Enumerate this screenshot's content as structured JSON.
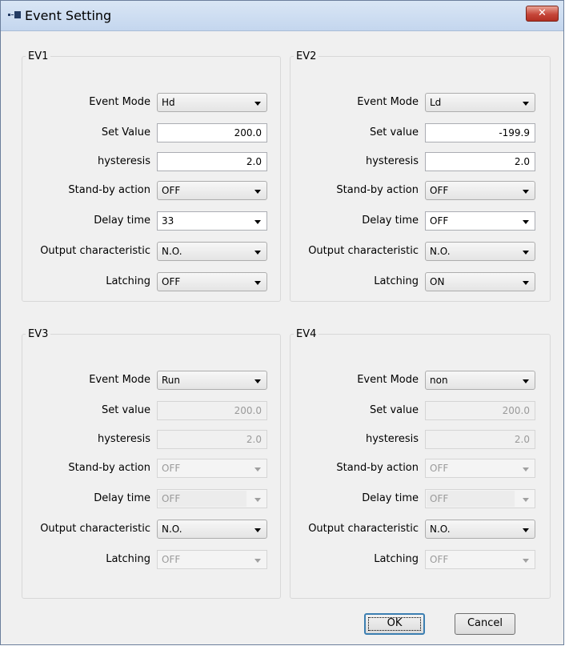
{
  "window": {
    "title": "Event Setting",
    "close_glyph": "✕"
  },
  "groups": [
    {
      "title": "EV1",
      "rows": [
        {
          "label": "Event Mode",
          "value": "Hd",
          "kind": "combo"
        },
        {
          "label": "Set Value",
          "value": "200.0",
          "kind": "edit"
        },
        {
          "label": "hysteresis",
          "value": "2.0",
          "kind": "edit"
        },
        {
          "label": "Stand-by action",
          "value": "OFF",
          "kind": "combo"
        },
        {
          "label": "Delay time",
          "value": "33",
          "kind": "combo-white"
        },
        {
          "label": "Output characteristic",
          "value": "N.O.",
          "kind": "combo"
        },
        {
          "label": "Latching",
          "value": "OFF",
          "kind": "combo"
        }
      ]
    },
    {
      "title": "EV2",
      "rows": [
        {
          "label": "Event Mode",
          "value": "Ld",
          "kind": "combo"
        },
        {
          "label": "Set value",
          "value": "-199.9",
          "kind": "edit"
        },
        {
          "label": "hysteresis",
          "value": "2.0",
          "kind": "edit"
        },
        {
          "label": "Stand-by action",
          "value": "OFF",
          "kind": "combo"
        },
        {
          "label": "Delay time",
          "value": "OFF",
          "kind": "combo-white"
        },
        {
          "label": "Output characteristic",
          "value": "N.O.",
          "kind": "combo"
        },
        {
          "label": "Latching",
          "value": "ON",
          "kind": "combo"
        }
      ]
    },
    {
      "title": "EV3",
      "rows": [
        {
          "label": "Event Mode",
          "value": "Run",
          "kind": "combo"
        },
        {
          "label": "Set value",
          "value": "200.0",
          "kind": "edit-disabled"
        },
        {
          "label": "hysteresis",
          "value": "2.0",
          "kind": "edit-disabled"
        },
        {
          "label": "Stand-by action",
          "value": "OFF",
          "kind": "combo-disabled"
        },
        {
          "label": "Delay time",
          "value": "OFF",
          "kind": "combo-disabled-edit"
        },
        {
          "label": "Output characteristic",
          "value": "N.O.",
          "kind": "combo"
        },
        {
          "label": "Latching",
          "value": "OFF",
          "kind": "combo-disabled"
        }
      ]
    },
    {
      "title": "EV4",
      "rows": [
        {
          "label": "Event Mode",
          "value": "non",
          "kind": "combo"
        },
        {
          "label": "Set value",
          "value": "200.0",
          "kind": "edit-disabled"
        },
        {
          "label": "hysteresis",
          "value": "2.0",
          "kind": "edit-disabled"
        },
        {
          "label": "Stand-by action",
          "value": "OFF",
          "kind": "combo-disabled"
        },
        {
          "label": "Delay time",
          "value": "OFF",
          "kind": "combo-disabled-edit"
        },
        {
          "label": "Output characteristic",
          "value": "N.O.",
          "kind": "combo"
        },
        {
          "label": "Latching",
          "value": "OFF",
          "kind": "combo-disabled"
        }
      ]
    }
  ],
  "buttons": {
    "ok": "OK",
    "cancel": "Cancel"
  },
  "colors": {
    "title_bar": "#c4d6ee",
    "close": "#c6473a",
    "default_border": "#3c7fb1",
    "disabled_text": "#9a9a9a"
  }
}
